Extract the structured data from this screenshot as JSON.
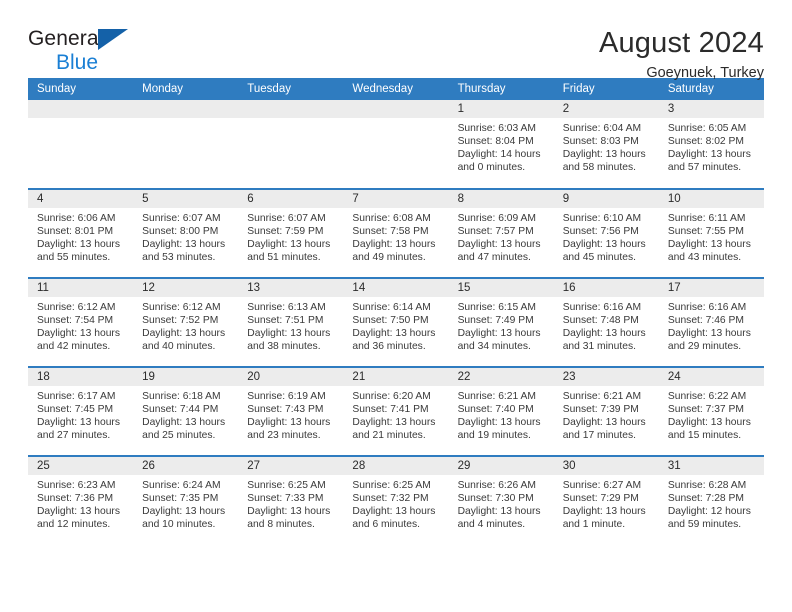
{
  "logo": {
    "word_one": "General",
    "word_two": "Blue",
    "triangle_color": "#1461a8",
    "blue_color": "#1a7fd4"
  },
  "header": {
    "title": "August 2024",
    "subtitle": "Goeynuek, Turkey"
  },
  "theme": {
    "header_bar": "#2f7cc0",
    "daynum_band": "#ececec",
    "text": "#2b2b2b"
  },
  "weekday_headers": [
    "Sunday",
    "Monday",
    "Tuesday",
    "Wednesday",
    "Thursday",
    "Friday",
    "Saturday"
  ],
  "weeks": [
    [
      {
        "day": "",
        "lines": []
      },
      {
        "day": "",
        "lines": []
      },
      {
        "day": "",
        "lines": []
      },
      {
        "day": "",
        "lines": []
      },
      {
        "day": "1",
        "lines": [
          "Sunrise: 6:03 AM",
          "Sunset: 8:04 PM",
          "Daylight: 14 hours",
          "and 0 minutes."
        ]
      },
      {
        "day": "2",
        "lines": [
          "Sunrise: 6:04 AM",
          "Sunset: 8:03 PM",
          "Daylight: 13 hours",
          "and 58 minutes."
        ]
      },
      {
        "day": "3",
        "lines": [
          "Sunrise: 6:05 AM",
          "Sunset: 8:02 PM",
          "Daylight: 13 hours",
          "and 57 minutes."
        ]
      }
    ],
    [
      {
        "day": "4",
        "lines": [
          "Sunrise: 6:06 AM",
          "Sunset: 8:01 PM",
          "Daylight: 13 hours",
          "and 55 minutes."
        ]
      },
      {
        "day": "5",
        "lines": [
          "Sunrise: 6:07 AM",
          "Sunset: 8:00 PM",
          "Daylight: 13 hours",
          "and 53 minutes."
        ]
      },
      {
        "day": "6",
        "lines": [
          "Sunrise: 6:07 AM",
          "Sunset: 7:59 PM",
          "Daylight: 13 hours",
          "and 51 minutes."
        ]
      },
      {
        "day": "7",
        "lines": [
          "Sunrise: 6:08 AM",
          "Sunset: 7:58 PM",
          "Daylight: 13 hours",
          "and 49 minutes."
        ]
      },
      {
        "day": "8",
        "lines": [
          "Sunrise: 6:09 AM",
          "Sunset: 7:57 PM",
          "Daylight: 13 hours",
          "and 47 minutes."
        ]
      },
      {
        "day": "9",
        "lines": [
          "Sunrise: 6:10 AM",
          "Sunset: 7:56 PM",
          "Daylight: 13 hours",
          "and 45 minutes."
        ]
      },
      {
        "day": "10",
        "lines": [
          "Sunrise: 6:11 AM",
          "Sunset: 7:55 PM",
          "Daylight: 13 hours",
          "and 43 minutes."
        ]
      }
    ],
    [
      {
        "day": "11",
        "lines": [
          "Sunrise: 6:12 AM",
          "Sunset: 7:54 PM",
          "Daylight: 13 hours",
          "and 42 minutes."
        ]
      },
      {
        "day": "12",
        "lines": [
          "Sunrise: 6:12 AM",
          "Sunset: 7:52 PM",
          "Daylight: 13 hours",
          "and 40 minutes."
        ]
      },
      {
        "day": "13",
        "lines": [
          "Sunrise: 6:13 AM",
          "Sunset: 7:51 PM",
          "Daylight: 13 hours",
          "and 38 minutes."
        ]
      },
      {
        "day": "14",
        "lines": [
          "Sunrise: 6:14 AM",
          "Sunset: 7:50 PM",
          "Daylight: 13 hours",
          "and 36 minutes."
        ]
      },
      {
        "day": "15",
        "lines": [
          "Sunrise: 6:15 AM",
          "Sunset: 7:49 PM",
          "Daylight: 13 hours",
          "and 34 minutes."
        ]
      },
      {
        "day": "16",
        "lines": [
          "Sunrise: 6:16 AM",
          "Sunset: 7:48 PM",
          "Daylight: 13 hours",
          "and 31 minutes."
        ]
      },
      {
        "day": "17",
        "lines": [
          "Sunrise: 6:16 AM",
          "Sunset: 7:46 PM",
          "Daylight: 13 hours",
          "and 29 minutes."
        ]
      }
    ],
    [
      {
        "day": "18",
        "lines": [
          "Sunrise: 6:17 AM",
          "Sunset: 7:45 PM",
          "Daylight: 13 hours",
          "and 27 minutes."
        ]
      },
      {
        "day": "19",
        "lines": [
          "Sunrise: 6:18 AM",
          "Sunset: 7:44 PM",
          "Daylight: 13 hours",
          "and 25 minutes."
        ]
      },
      {
        "day": "20",
        "lines": [
          "Sunrise: 6:19 AM",
          "Sunset: 7:43 PM",
          "Daylight: 13 hours",
          "and 23 minutes."
        ]
      },
      {
        "day": "21",
        "lines": [
          "Sunrise: 6:20 AM",
          "Sunset: 7:41 PM",
          "Daylight: 13 hours",
          "and 21 minutes."
        ]
      },
      {
        "day": "22",
        "lines": [
          "Sunrise: 6:21 AM",
          "Sunset: 7:40 PM",
          "Daylight: 13 hours",
          "and 19 minutes."
        ]
      },
      {
        "day": "23",
        "lines": [
          "Sunrise: 6:21 AM",
          "Sunset: 7:39 PM",
          "Daylight: 13 hours",
          "and 17 minutes."
        ]
      },
      {
        "day": "24",
        "lines": [
          "Sunrise: 6:22 AM",
          "Sunset: 7:37 PM",
          "Daylight: 13 hours",
          "and 15 minutes."
        ]
      }
    ],
    [
      {
        "day": "25",
        "lines": [
          "Sunrise: 6:23 AM",
          "Sunset: 7:36 PM",
          "Daylight: 13 hours",
          "and 12 minutes."
        ]
      },
      {
        "day": "26",
        "lines": [
          "Sunrise: 6:24 AM",
          "Sunset: 7:35 PM",
          "Daylight: 13 hours",
          "and 10 minutes."
        ]
      },
      {
        "day": "27",
        "lines": [
          "Sunrise: 6:25 AM",
          "Sunset: 7:33 PM",
          "Daylight: 13 hours",
          "and 8 minutes."
        ]
      },
      {
        "day": "28",
        "lines": [
          "Sunrise: 6:25 AM",
          "Sunset: 7:32 PM",
          "Daylight: 13 hours",
          "and 6 minutes."
        ]
      },
      {
        "day": "29",
        "lines": [
          "Sunrise: 6:26 AM",
          "Sunset: 7:30 PM",
          "Daylight: 13 hours",
          "and 4 minutes."
        ]
      },
      {
        "day": "30",
        "lines": [
          "Sunrise: 6:27 AM",
          "Sunset: 7:29 PM",
          "Daylight: 13 hours",
          "and 1 minute."
        ]
      },
      {
        "day": "31",
        "lines": [
          "Sunrise: 6:28 AM",
          "Sunset: 7:28 PM",
          "Daylight: 12 hours",
          "and 59 minutes."
        ]
      }
    ]
  ]
}
